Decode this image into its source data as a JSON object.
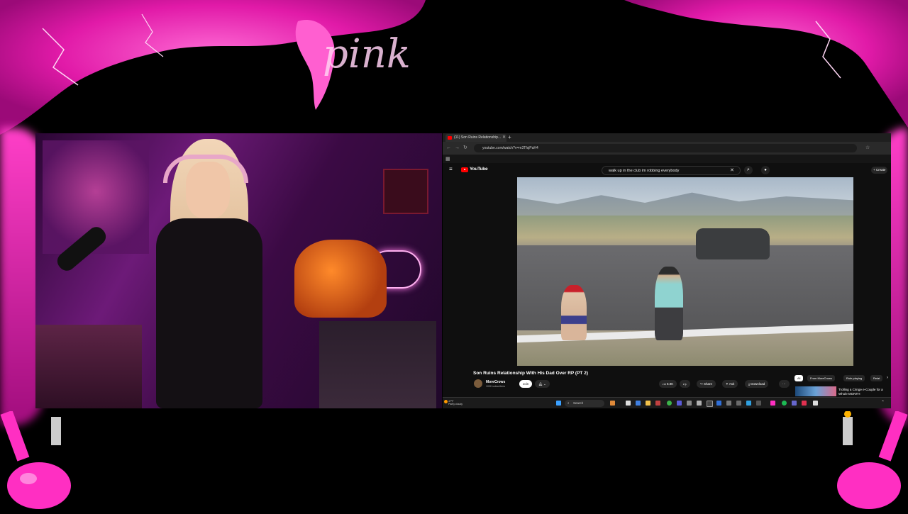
{
  "browser": {
    "tab_title": "(11) Son Ruins Relationship...",
    "url": "youtube.com/watch?v=m3TfsjPaH4"
  },
  "youtube": {
    "brand": "YouTube",
    "search_query": "walk up in the club im robbing everybody",
    "create_label": "Create"
  },
  "video": {
    "title": "Son Ruins Relationship With His Dad Over RP (PT 2)",
    "channel": "MoreCrows",
    "subscribers": "100K subscribers",
    "join_label": "Join",
    "likes": "6.9K",
    "share_label": "Share",
    "ask_label": "Ask",
    "download_label": "Download"
  },
  "chips": [
    "All",
    "From MoreCrows",
    "Role-playing",
    "Relat"
  ],
  "recommended": {
    "title": "Trolling a Cringe e-Couple for a Whole MONTH"
  },
  "taskbar": {
    "weather_temp": "47°F",
    "weather_desc": "Partly cloudy",
    "search_label": "Search"
  },
  "overlay": {
    "logo_text": "pink"
  },
  "colors": {
    "accent_pink": "#ff2fc2",
    "youtube_red": "#ff0000"
  }
}
